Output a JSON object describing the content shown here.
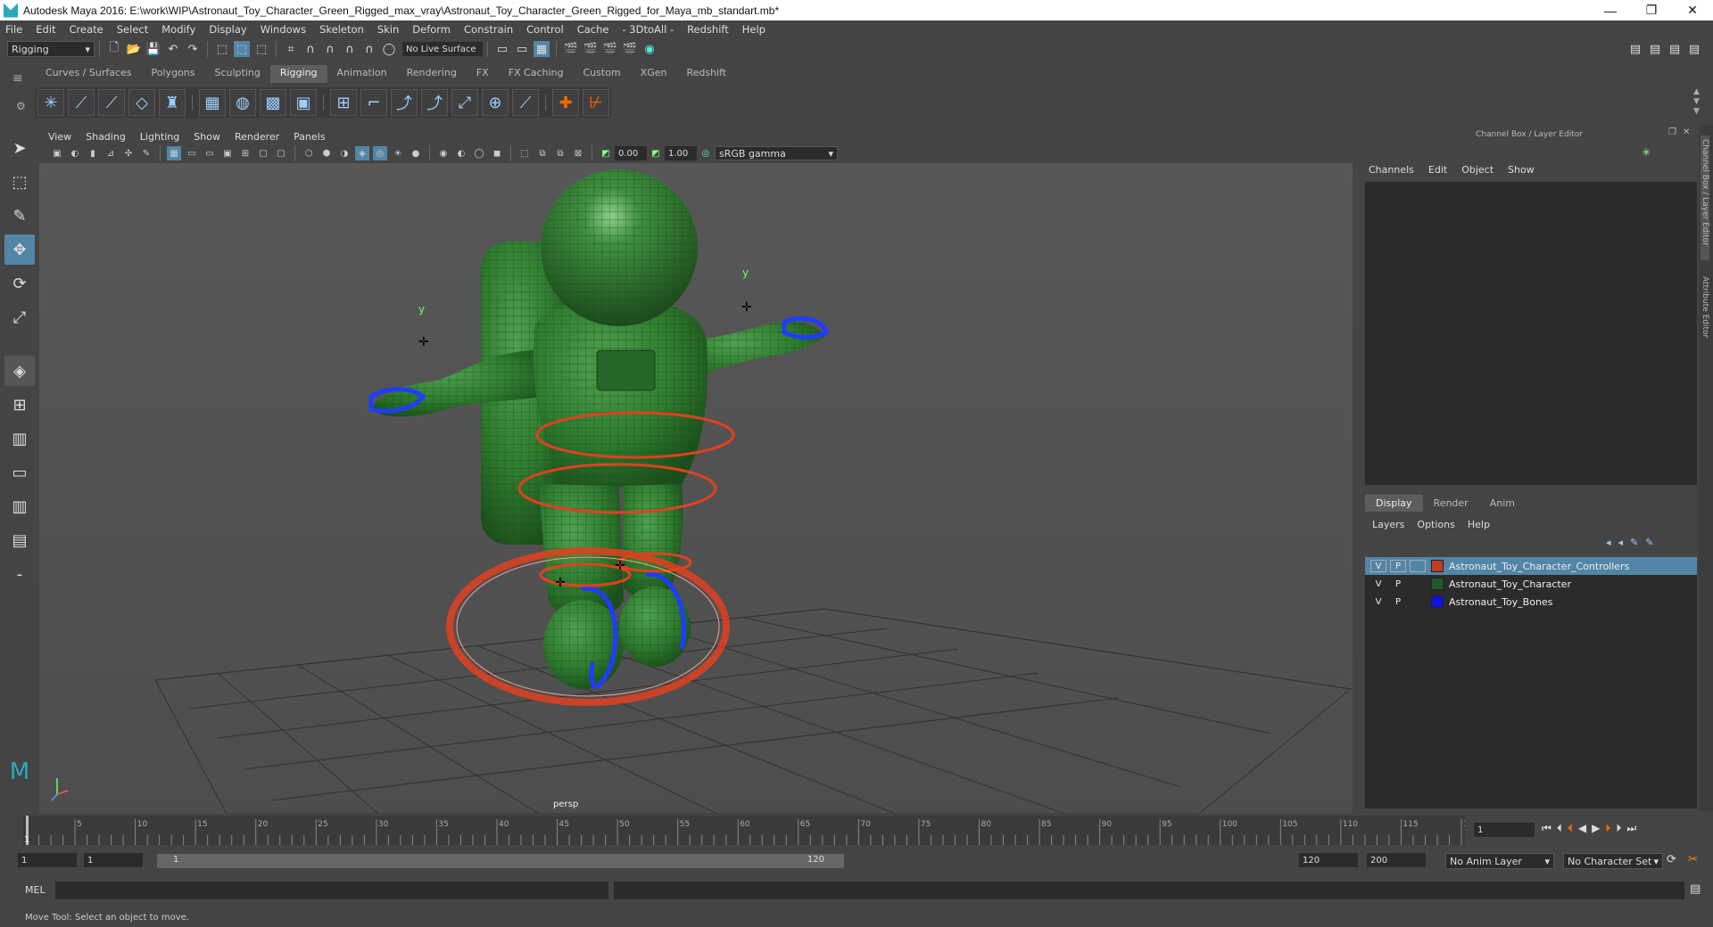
{
  "window": {
    "title": "Autodesk Maya 2016: E:\\work\\WIP\\Astronaut_Toy_Character_Green_Rigged_max_vray\\Astronaut_Toy_Character_Green_Rigged_for_Maya_mb_standart.mb*",
    "minimize": "—",
    "restore": "❐",
    "close": "✕"
  },
  "menubar": [
    "File",
    "Edit",
    "Create",
    "Select",
    "Modify",
    "Display",
    "Windows",
    "Skeleton",
    "Skin",
    "Deform",
    "Constrain",
    "Control",
    "Cache",
    "- 3DtoAll -",
    "Redshift",
    "Help"
  ],
  "statusline": {
    "menuset": "Rigging",
    "live_surface": "No Live Surface"
  },
  "shelf": {
    "tabs": [
      "Curves / Surfaces",
      "Polygons",
      "Sculpting",
      "Rigging",
      "Animation",
      "Rendering",
      "FX",
      "FX Caching",
      "Custom",
      "XGen",
      "Redshift"
    ],
    "active_tab": "Rigging"
  },
  "viewport": {
    "menu": [
      "View",
      "Shading",
      "Lighting",
      "Show",
      "Renderer",
      "Panels"
    ],
    "exposure": "0.00",
    "gamma": "1.00",
    "colorspace": "sRGB gamma",
    "camera_label": "persp",
    "axis_y_label": "y"
  },
  "channel_box": {
    "header": "Channel Box / Layer Editor",
    "menu": [
      "Channels",
      "Edit",
      "Object",
      "Show"
    ]
  },
  "layer_editor": {
    "tabs": [
      "Display",
      "Render",
      "Anim"
    ],
    "active_tab": "Display",
    "menu": [
      "Layers",
      "Options",
      "Help"
    ],
    "layers": [
      {
        "v": "V",
        "p": "P",
        "name": "Astronaut_Toy_Character_Controllers",
        "color": "#c23b22",
        "selected": true
      },
      {
        "v": "V",
        "p": "P",
        "name": "Astronaut_Toy_Character",
        "color": "#1f5a2a",
        "selected": false
      },
      {
        "v": "V",
        "p": "P",
        "name": "Astronaut_Toy_Bones",
        "color": "#1010e0",
        "selected": false
      }
    ]
  },
  "side_tabs": [
    "Channel Box / Layer Editor",
    "Attribute Editor"
  ],
  "timeline": {
    "ticks": [
      "5",
      "10",
      "15",
      "20",
      "25",
      "30",
      "35",
      "40",
      "45",
      "50",
      "55",
      "60",
      "65",
      "70",
      "75",
      "80",
      "85",
      "90",
      "95",
      "100",
      "105",
      "110",
      "115",
      "120"
    ],
    "current_frame_marker": "1",
    "current_frame": "1"
  },
  "range": {
    "start": "1",
    "playback_start": "1",
    "slider_start": "1",
    "slider_end": "120",
    "playback_end": "120",
    "end": "200",
    "anim_layer": "No Anim Layer",
    "character_set": "No Character Set"
  },
  "command": {
    "mel_label": "MEL"
  },
  "help": "Move Tool: Select an object to move."
}
